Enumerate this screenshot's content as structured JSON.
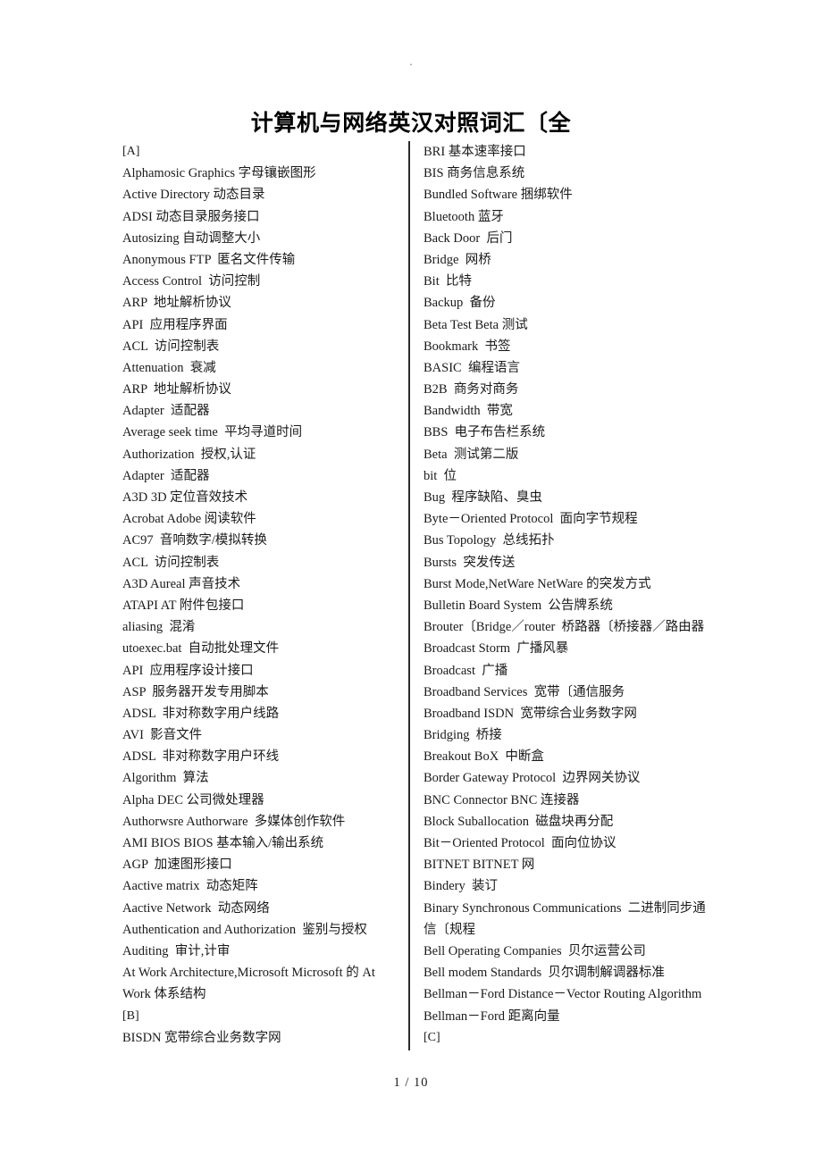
{
  "page": {
    "top_mark": ".",
    "title": "计算机与网络英汉对照词汇〔全",
    "footer": "1  / 10"
  },
  "left_column": {
    "entries": [
      "[A]",
      "Alphamosic Graphics 字母镶嵌图形",
      "Active Directory 动态目录",
      "ADSI 动态目录服务接口",
      "Autosizing 自动调整大小",
      "Anonymous FTP  匿名文件传输",
      "Access Control  访问控制",
      "ARP  地址解析协议",
      "API  应用程序界面",
      "ACL  访问控制表",
      "Attenuation  衰减",
      "ARP  地址解析协议",
      "Adapter  适配器",
      "Average seek time  平均寻道时间",
      "Authorization  授权,认证",
      "Adapter  适配器",
      "A3D 3D 定位音效技术",
      "Acrobat Adobe 阅读软件",
      "AC97  音响数字/模拟转换",
      "ACL  访问控制表",
      "A3D Aureal 声音技术",
      "ATAPI AT 附件包接口",
      "aliasing  混淆",
      "utoexec.bat  自动批处理文件",
      "API  应用程序设计接口",
      "ASP  服务器开发专用脚本",
      "ADSL  非对称数字用户线路",
      "AVI  影音文件",
      "ADSL  非对称数字用户环线",
      "Algorithm  算法",
      "Alpha DEC 公司微处理器",
      "Authorwsre Authorware  多媒体创作软件",
      "AMI BIOS BIOS 基本输入/输出系统",
      "AGP  加速图形接口",
      "Aactive matrix  动态矩阵",
      "Aactive Network  动态网络",
      "Authentication and Authorization  鉴别与授权",
      "Auditing  审计,计审",
      "At Work Architecture,Microsoft Microsoft 的 At Work 体系结构",
      "[B]",
      "BISDN 宽带综合业务数字网"
    ]
  },
  "right_column": {
    "entries": [
      "BRI 基本速率接口",
      "BIS 商务信息系统",
      "Bundled Software 捆绑软件",
      "Bluetooth 蓝牙",
      "Back Door  后门",
      "Bridge  网桥",
      "Bit  比特",
      "Backup  备份",
      "Beta Test Beta 测试",
      "Bookmark  书签",
      "BASIC  编程语言",
      "B2B  商务对商务",
      "Bandwidth  带宽",
      "BBS  电子布告栏系统",
      "Beta  测试第二版",
      "bit  位",
      "Bug  程序缺陷、臭虫",
      "Byte－Oriented Protocol  面向字节规程",
      "Bus Topology  总线拓扑",
      "Bursts  突发传送",
      "Burst Mode,NetWare NetWare 的突发方式",
      "Bulletin Board System  公告牌系统",
      "Brouter〔Bridge／router  桥路器〔桥接器／路由器",
      "Broadcast Storm  广播风暴",
      "Broadcast  广播",
      "Broadband Services  宽带〔通信服务",
      "Broadband ISDN  宽带综合业务数字网",
      "Bridging  桥接",
      "Breakout BoX  中断盒",
      "Border Gateway Protocol  边界网关协议",
      "BNC Connector BNC 连接器",
      "Block Suballocation  磁盘块再分配",
      "Bit－Oriented Protocol  面向位协议",
      "BITNET BITNET 网",
      "Bindery  装订",
      "Binary Synchronous Communications  二进制同步通信〔规程",
      "Bell Operating Companies  贝尔运营公司",
      "Bell modem Standards  贝尔调制解调器标准",
      "Bellman－Ford Distance－Vector Routing Algorithm Bellman－Ford 距离向量",
      "[C]"
    ]
  }
}
